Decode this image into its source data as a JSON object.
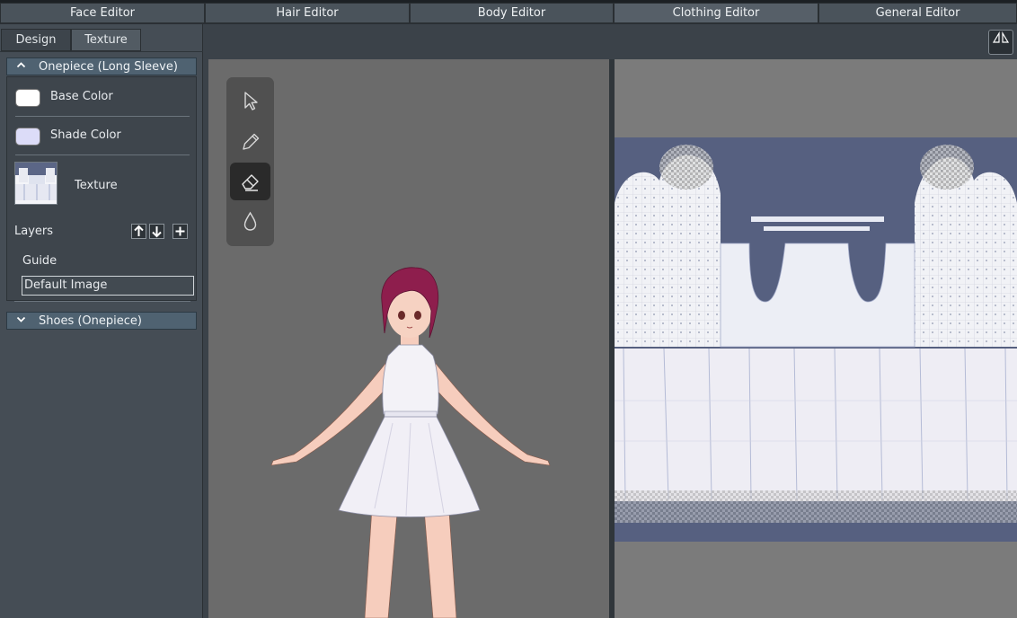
{
  "top_tabs": [
    {
      "label": "Face Editor"
    },
    {
      "label": "Hair Editor"
    },
    {
      "label": "Body Editor"
    },
    {
      "label": "Clothing Editor"
    },
    {
      "label": "General Editor"
    }
  ],
  "left_panel": {
    "subtabs": [
      {
        "label": "Design"
      },
      {
        "label": "Texture"
      }
    ],
    "active_subtab": "Texture",
    "section": {
      "title": "Onepiece (Long Sleeve)",
      "base_color_label": "Base Color",
      "base_color": "#ffffff",
      "shade_color_label": "Shade Color",
      "shade_color": "#dcdcf8",
      "texture_label": "Texture",
      "layers_label": "Layers",
      "layers": [
        {
          "label": "Guide"
        },
        {
          "label": "Default Image"
        }
      ]
    },
    "collapsed_section": {
      "title": "Shoes (Onepiece)"
    }
  },
  "tools": [
    {
      "icon": "cursor-icon"
    },
    {
      "icon": "pencil-icon"
    },
    {
      "icon": "eraser-icon"
    },
    {
      "icon": "droplet-icon"
    }
  ],
  "active_tool": "eraser",
  "colors": {
    "accent": "#4f6271",
    "uv_background": "#566080",
    "viewport_bg": "#6b6b6b"
  }
}
